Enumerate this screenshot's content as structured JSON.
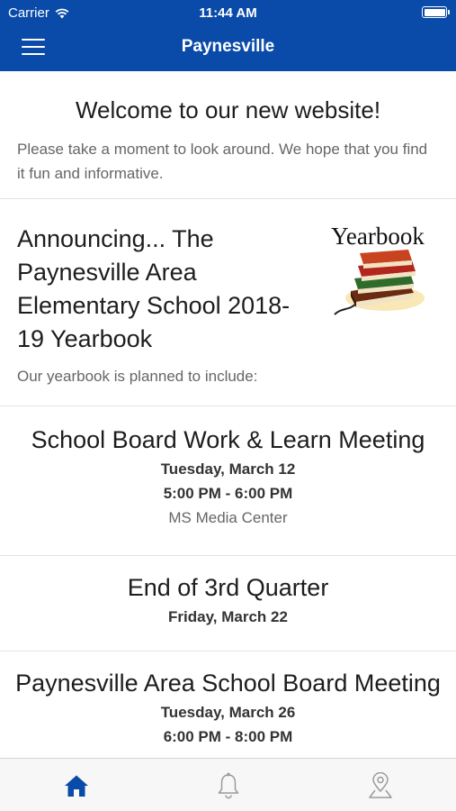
{
  "status_bar": {
    "carrier": "Carrier",
    "time": "11:44 AM"
  },
  "nav": {
    "title": "Paynesville",
    "menu_icon": "hamburger-menu-icon"
  },
  "welcome": {
    "title": "Welcome to our new website!",
    "body": "Please take a moment to look around. We hope that you find it fun and informative."
  },
  "announcement": {
    "title": "Announcing... The Paynesville Area Elementary School 2018-19 Yearbook",
    "subtitle": "Our yearbook is planned to include:",
    "image_caption": "Yearbook"
  },
  "events": [
    {
      "title": "School Board Work & Learn Meeting",
      "date": "Tuesday, March 12",
      "time": "5:00 PM - 6:00 PM",
      "location": "MS Media Center"
    },
    {
      "title": "End of 3rd Quarter",
      "date": "Friday, March 22"
    },
    {
      "title": "Paynesville Area School Board Meeting",
      "date": "Tuesday, March 26",
      "time": "6:00 PM - 8:00 PM"
    }
  ],
  "tab_bar": {
    "tabs": [
      {
        "icon": "home-icon",
        "active": true
      },
      {
        "icon": "bell-icon",
        "active": false
      },
      {
        "icon": "map-pin-icon",
        "active": false
      }
    ]
  },
  "colors": {
    "brand_blue": "#0a4aa8",
    "tab_active": "#0a4aa8",
    "tab_inactive": "#9a9a9a"
  }
}
